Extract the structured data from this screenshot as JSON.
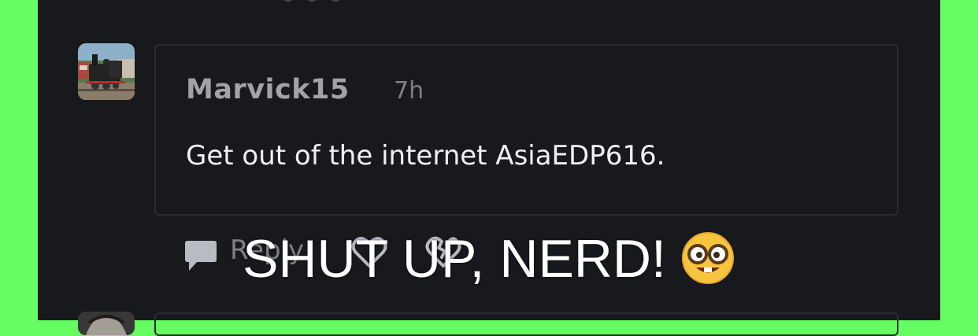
{
  "comment": {
    "username": "Marvick15",
    "timestamp": "7h",
    "text": "Get out of the internet AsiaEDP616.",
    "avatar_icon": "steam-locomotive-avatar"
  },
  "actions": {
    "reply_label": "Reply",
    "reply_icon": "speech-bubble-icon",
    "like_icon": "heart-icon",
    "dislike_icon": "broken-heart-icon"
  },
  "meme": {
    "caption": "SHUT UP, NERD!",
    "emoji_icon": "nerd-face-emoji"
  },
  "colors": {
    "border": "#65fd62",
    "background": "#18191d",
    "username": "#a1a3a8",
    "text": "#eef0f3",
    "muted": "#7d8087"
  }
}
